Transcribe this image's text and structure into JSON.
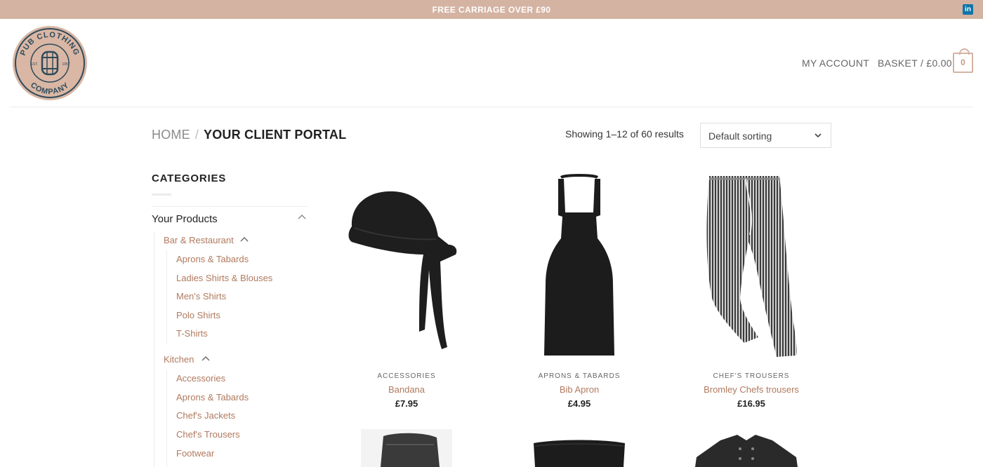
{
  "topbar": {
    "message": "FREE CARRIAGE OVER £90",
    "social_icon": "linkedin-icon",
    "social_text": "in"
  },
  "header": {
    "logo_text": {
      "top": "PUB CLOTHING",
      "bottom": "COMPANY",
      "left": "EST.",
      "right": "1957"
    },
    "my_account": "MY ACCOUNT",
    "basket": "BASKET / £0.00",
    "basket_count": "0"
  },
  "breadcrumb": {
    "home": "HOME",
    "separator": "/",
    "current": "YOUR CLIENT PORTAL"
  },
  "results_text": "Showing 1–12 of 60 results",
  "sort": {
    "selected": "Default sorting"
  },
  "sidebar": {
    "title": "CATEGORIES",
    "root": "Your Products",
    "groups": [
      {
        "label": "Bar & Restaurant",
        "items": [
          "Aprons & Tabards",
          "Ladies Shirts & Blouses",
          "Men's Shirts",
          "Polo Shirts",
          "T-Shirts"
        ]
      },
      {
        "label": "Kitchen",
        "items": [
          "Accessories",
          "Aprons & Tabards",
          "Chef's Jackets",
          "Chef's Trousers",
          "Footwear"
        ]
      }
    ]
  },
  "products": [
    {
      "category": "ACCESSORIES",
      "name": "Bandana",
      "price": "£7.95"
    },
    {
      "category": "APRONS & TABARDS",
      "name": "Bib Apron",
      "price": "£4.95"
    },
    {
      "category": "CHEF'S TROUSERS",
      "name": "Bromley Chefs trousers",
      "price": "£16.95"
    }
  ],
  "colors": {
    "accent": "#d4b3a2",
    "link": "#b07a5e",
    "logo_navy": "#2f4a5c"
  }
}
